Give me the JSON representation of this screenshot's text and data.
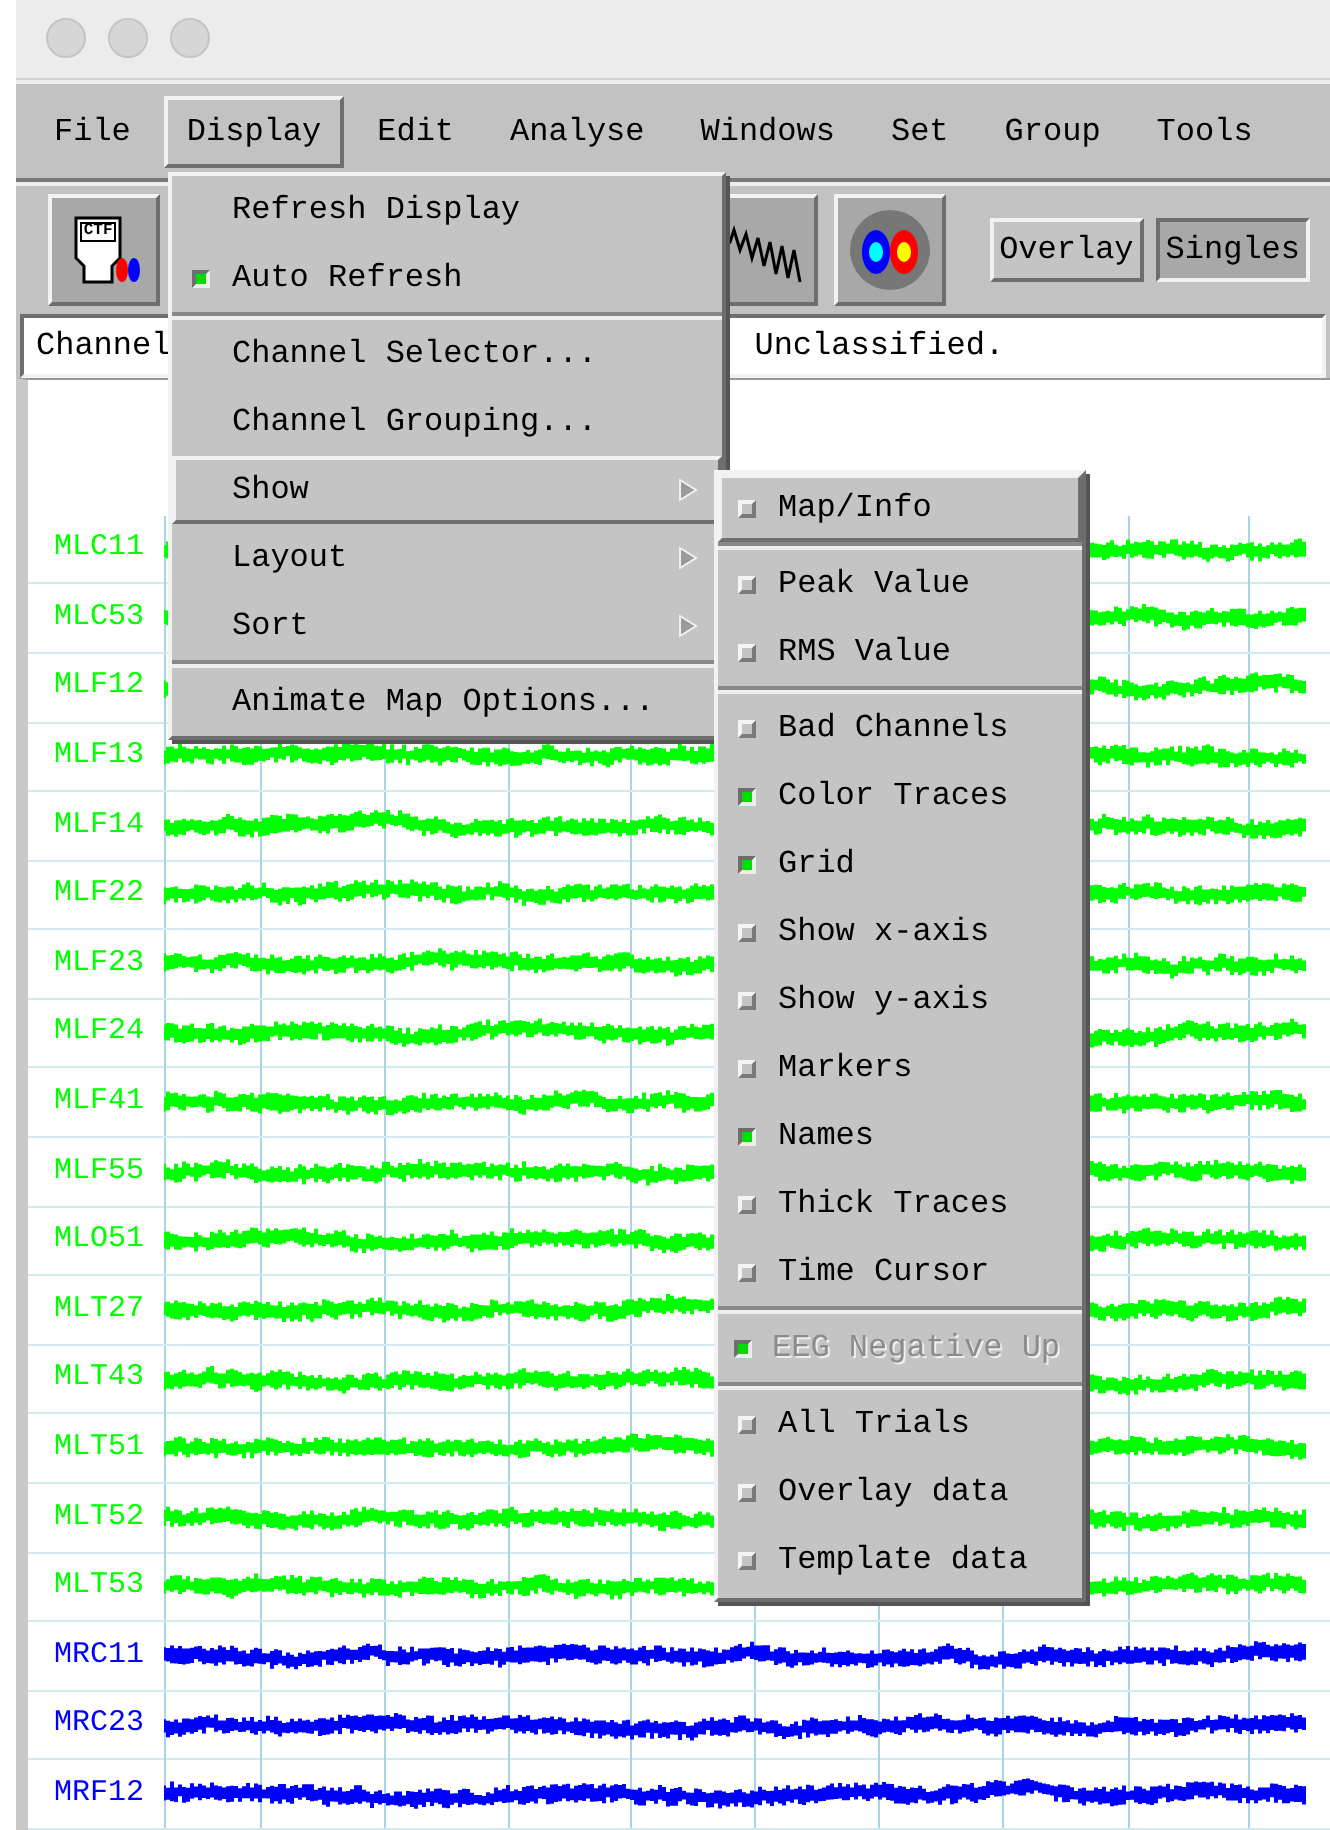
{
  "menubar": [
    {
      "label": "File",
      "selected": false
    },
    {
      "label": "Display",
      "selected": true
    },
    {
      "label": "Edit",
      "selected": false
    },
    {
      "label": "Analyse",
      "selected": false
    },
    {
      "label": "Windows",
      "selected": false
    },
    {
      "label": "Set",
      "selected": false
    },
    {
      "label": "Group",
      "selected": false
    },
    {
      "label": "Tools",
      "selected": false
    }
  ],
  "toolbar": {
    "icon_buttons": [
      {
        "kind": "ctf",
        "label": "CTF"
      },
      {
        "kind": "waveform"
      },
      {
        "kind": "dipoles"
      }
    ],
    "mode_buttons": [
      {
        "label": "Overlay",
        "selected": false
      },
      {
        "label": "Singles",
        "selected": true
      }
    ]
  },
  "status": {
    "left": "Channel",
    "right": "Unclassified."
  },
  "display_menu": [
    {
      "kind": "command",
      "label": "Refresh Display",
      "selected": false
    },
    {
      "kind": "check",
      "label": "Auto Refresh",
      "checked": true,
      "selected": false
    },
    {
      "kind": "separator"
    },
    {
      "kind": "command",
      "label": "Channel Selector...",
      "selected": false
    },
    {
      "kind": "command",
      "label": "Channel Grouping...",
      "selected": false
    },
    {
      "kind": "submenu",
      "label": "Show",
      "selected": true
    },
    {
      "kind": "submenu",
      "label": "Layout",
      "selected": false
    },
    {
      "kind": "submenu",
      "label": "Sort",
      "selected": false
    },
    {
      "kind": "separator"
    },
    {
      "kind": "command",
      "label": "Animate Map Options...",
      "selected": false
    }
  ],
  "show_submenu": [
    {
      "kind": "check",
      "label": "Map/Info",
      "checked": false,
      "disabled": false,
      "selected": true
    },
    {
      "kind": "separator"
    },
    {
      "kind": "check",
      "label": "Peak Value",
      "checked": false,
      "disabled": false,
      "selected": false
    },
    {
      "kind": "check",
      "label": "RMS Value",
      "checked": false,
      "disabled": false,
      "selected": false
    },
    {
      "kind": "separator"
    },
    {
      "kind": "check",
      "label": "Bad Channels",
      "checked": false,
      "disabled": false,
      "selected": false
    },
    {
      "kind": "check",
      "label": "Color Traces",
      "checked": true,
      "disabled": false,
      "selected": false
    },
    {
      "kind": "check",
      "label": "Grid",
      "checked": true,
      "disabled": false,
      "selected": false
    },
    {
      "kind": "check",
      "label": "Show x-axis",
      "checked": false,
      "disabled": false,
      "selected": false
    },
    {
      "kind": "check",
      "label": "Show y-axis",
      "checked": false,
      "disabled": false,
      "selected": false
    },
    {
      "kind": "check",
      "label": "Markers",
      "checked": false,
      "disabled": false,
      "selected": false
    },
    {
      "kind": "check",
      "label": "Names",
      "checked": true,
      "disabled": false,
      "selected": false
    },
    {
      "kind": "check",
      "label": "Thick Traces",
      "checked": false,
      "disabled": false,
      "selected": false
    },
    {
      "kind": "check",
      "label": "Time Cursor",
      "checked": false,
      "disabled": false,
      "selected": false
    },
    {
      "kind": "separator"
    },
    {
      "kind": "check",
      "label": "EEG Negative Up",
      "checked": true,
      "disabled": true,
      "selected": false
    },
    {
      "kind": "separator"
    },
    {
      "kind": "check",
      "label": "All Trials",
      "checked": false,
      "disabled": false,
      "selected": false
    },
    {
      "kind": "check",
      "label": "Overlay data",
      "checked": false,
      "disabled": false,
      "selected": false
    },
    {
      "kind": "check",
      "label": "Template data",
      "checked": false,
      "disabled": false,
      "selected": false
    }
  ],
  "channels": [
    {
      "name": "MLC11",
      "color": "#00ff00"
    },
    {
      "name": "MLC53",
      "color": "#00ff00"
    },
    {
      "name": "MLF12",
      "color": "#00ff00"
    },
    {
      "name": "MLF13",
      "color": "#00ff00"
    },
    {
      "name": "MLF14",
      "color": "#00ff00"
    },
    {
      "name": "MLF22",
      "color": "#00ff00"
    },
    {
      "name": "MLF23",
      "color": "#00ff00"
    },
    {
      "name": "MLF24",
      "color": "#00ff00"
    },
    {
      "name": "MLF41",
      "color": "#00ff00"
    },
    {
      "name": "MLF55",
      "color": "#00ff00"
    },
    {
      "name": "MLO51",
      "color": "#00ff00"
    },
    {
      "name": "MLT27",
      "color": "#00ff00"
    },
    {
      "name": "MLT43",
      "color": "#00ff00"
    },
    {
      "name": "MLT51",
      "color": "#00ff00"
    },
    {
      "name": "MLT52",
      "color": "#00ff00"
    },
    {
      "name": "MLT53",
      "color": "#00ff00"
    },
    {
      "name": "MRC11",
      "color": "#0000ff"
    },
    {
      "name": "MRC23",
      "color": "#0000ff"
    },
    {
      "name": "MRF12",
      "color": "#0000ff"
    }
  ]
}
